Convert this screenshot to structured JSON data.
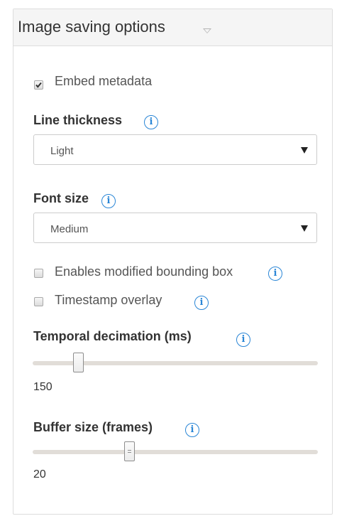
{
  "panel": {
    "title": "Image saving options"
  },
  "embed_metadata": {
    "label": "Embed metadata",
    "checked": true
  },
  "line_thickness": {
    "label": "Line thickness",
    "info_glyph": "i",
    "selected": "Light"
  },
  "font_size": {
    "label": "Font size",
    "info_glyph": "i",
    "selected": "Medium"
  },
  "modified_bbox": {
    "label": "Enables modified bounding box",
    "info_glyph": "i",
    "checked": false
  },
  "timestamp_overlay": {
    "label": "Timestamp overlay",
    "info_glyph": "i",
    "checked": false
  },
  "temporal_decimation": {
    "label": "Temporal decimation (ms)",
    "info_glyph": "i",
    "value": "150",
    "position_fraction": 0.16
  },
  "buffer_size": {
    "label": "Buffer size (frames)",
    "info_glyph": "i",
    "value": "20",
    "position_fraction": 0.34
  },
  "colors": {
    "info_blue": "#2a86d6",
    "slider_track": "#e1ddd8",
    "header_bg": "#f5f5f5"
  }
}
